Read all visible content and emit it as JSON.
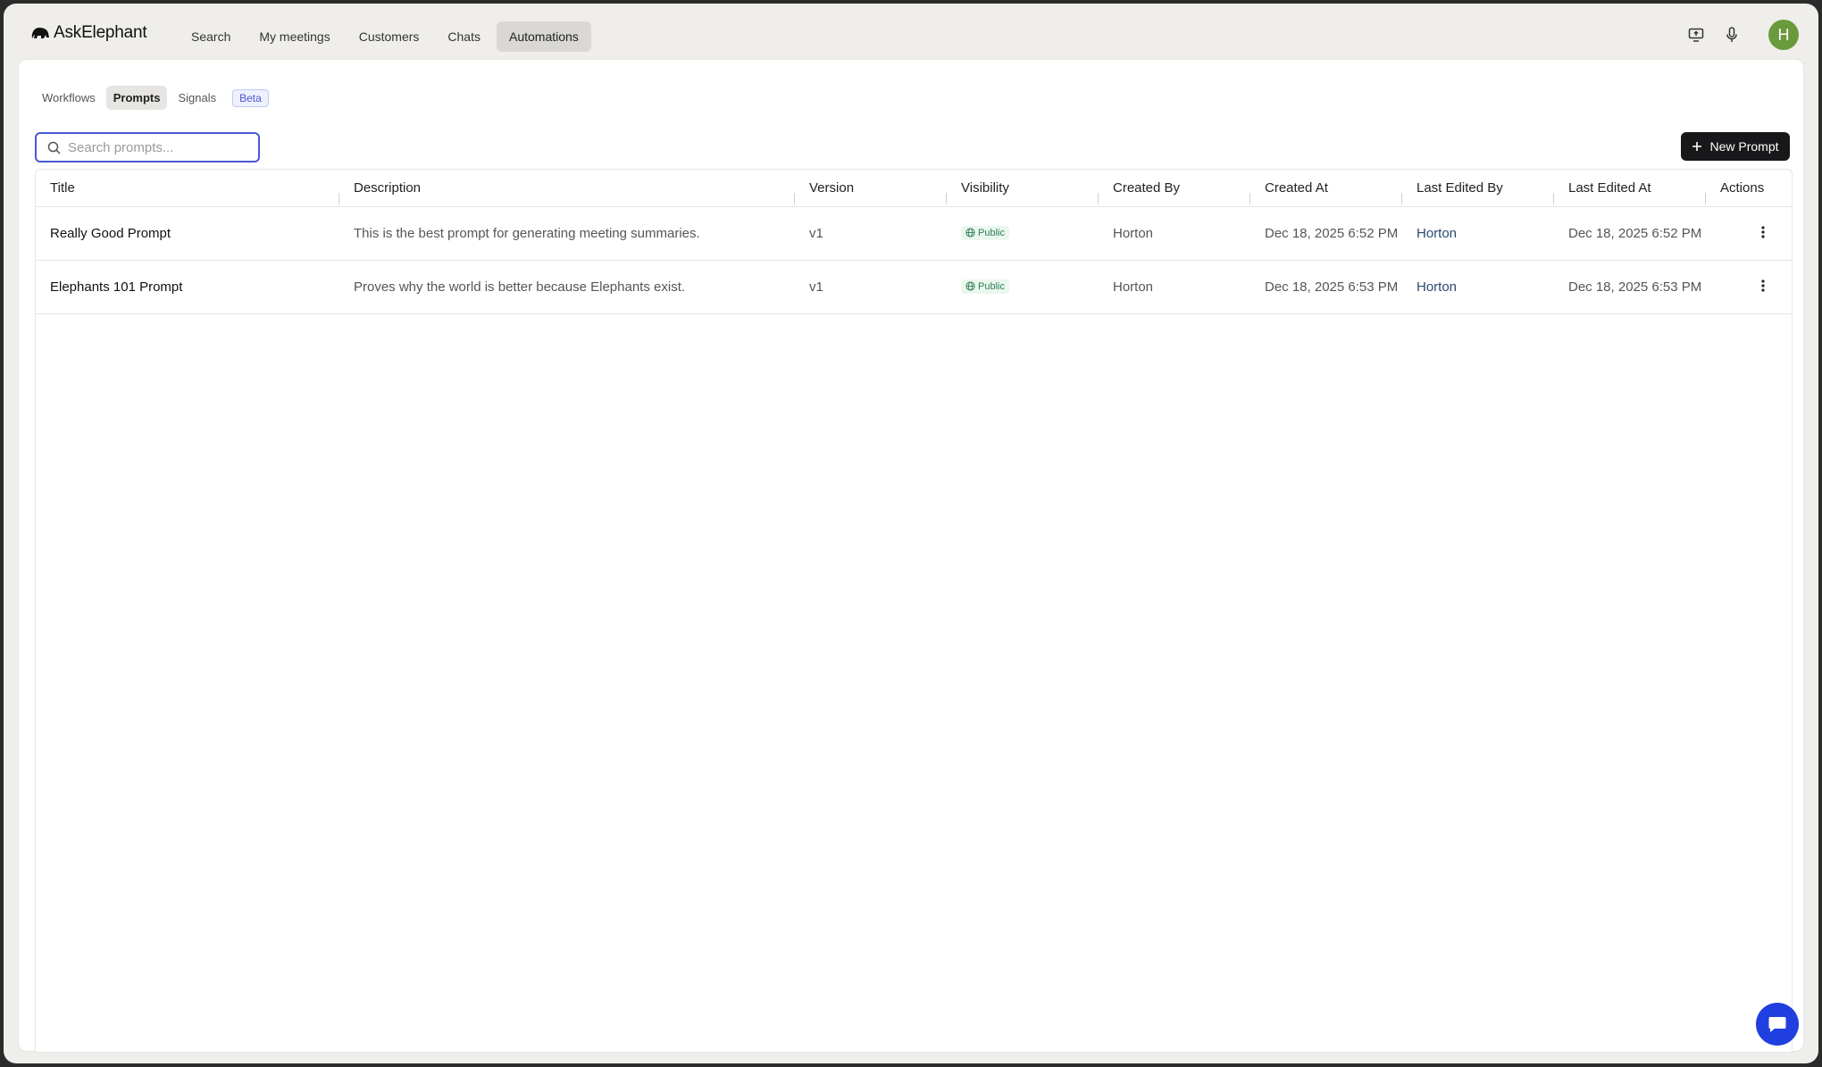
{
  "app": {
    "name": "AskElephant"
  },
  "nav": {
    "links": [
      {
        "label": "Search"
      },
      {
        "label": "My meetings"
      },
      {
        "label": "Customers"
      },
      {
        "label": "Chats"
      },
      {
        "label": "Automations"
      }
    ],
    "active": "Automations",
    "icons": [
      "screen-share-icon",
      "microphone-icon"
    ],
    "avatar_initial": "H",
    "avatar_color": "#6a9a3c"
  },
  "subtabs": {
    "items": [
      {
        "label": "Workflows"
      },
      {
        "label": "Prompts"
      },
      {
        "label": "Signals"
      }
    ],
    "active": "Prompts",
    "badge": "Beta"
  },
  "search": {
    "placeholder": "Search prompts...",
    "value": ""
  },
  "new_button": {
    "label": "New Prompt"
  },
  "table": {
    "columns": [
      "Title",
      "Description",
      "Version",
      "Visibility",
      "Created By",
      "Created At",
      "Last Edited By",
      "Last Edited At",
      "Actions"
    ],
    "rows": [
      {
        "title": "Really Good Prompt",
        "description": "This is the best prompt for generating meeting summaries.",
        "version": "v1",
        "visibility": "Public",
        "created_by": "Horton",
        "created_at": "Dec 18, 2025 6:52 PM",
        "last_edited_by": "Horton",
        "last_edited_at": "Dec 18, 2025 6:52 PM"
      },
      {
        "title": "Elephants 101 Prompt",
        "description": "Proves why the world is better because Elephants exist.",
        "version": "v1",
        "visibility": "Public",
        "created_by": "Horton",
        "created_at": "Dec 18, 2025 6:53 PM",
        "last_edited_by": "Horton",
        "last_edited_at": "Dec 18, 2025 6:53 PM"
      }
    ]
  },
  "colors": {
    "accent": "#4a57d4",
    "primary_button": "#18181b",
    "public_badge": "#2e7d54",
    "chat_bubble": "#1f3fe0"
  }
}
